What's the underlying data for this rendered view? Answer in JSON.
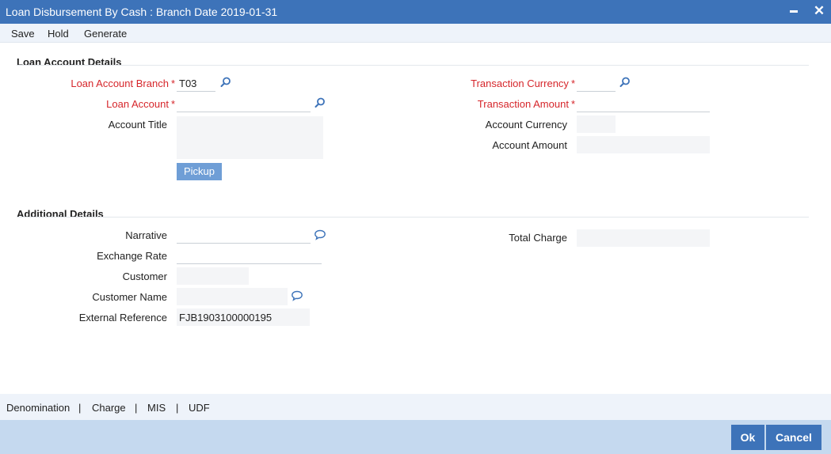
{
  "window": {
    "title": "Loan Disbursement By Cash : Branch Date 2019-01-31",
    "minimize_glyph": "▬",
    "close_glyph": "✕"
  },
  "menu": {
    "save": "Save",
    "hold": "Hold",
    "generate": "Generate"
  },
  "loan_account_details": {
    "heading": "Loan Account Details",
    "branch_label": "Loan Account Branch",
    "branch_value": "T03",
    "loan_account_label": "Loan Account",
    "loan_account_value": "",
    "account_title_label": "Account Title",
    "account_title_value": "",
    "pickup_label": "Pickup",
    "txn_currency_label": "Transaction Currency",
    "txn_currency_value": "",
    "txn_amount_label": "Transaction Amount",
    "txn_amount_value": "",
    "account_currency_label": "Account Currency",
    "account_currency_value": "",
    "account_amount_label": "Account Amount",
    "account_amount_value": "",
    "required_mark": "*"
  },
  "additional_details": {
    "heading": "Additional Details",
    "narrative_label": "Narrative",
    "narrative_value": "",
    "exchange_rate_label": "Exchange Rate",
    "exchange_rate_value": "",
    "customer_label": "Customer",
    "customer_value": "",
    "customer_name_label": "Customer Name",
    "customer_name_value": "",
    "external_reference_label": "External Reference",
    "external_reference_value": "FJB1903100000195",
    "total_charge_label": "Total Charge",
    "total_charge_value": ""
  },
  "tabs": {
    "denomination": "Denomination",
    "charge": "Charge",
    "mis": "MIS",
    "udf": "UDF",
    "separator": "|"
  },
  "footer": {
    "ok": "Ok",
    "cancel": "Cancel"
  },
  "icons": {
    "lookup": "search-icon",
    "comment": "speech-bubble-icon"
  },
  "colors": {
    "title_bar": "#3d73b9",
    "required_label": "#d6262b",
    "button": "#3d73b9",
    "footer": "#c5d9ef"
  }
}
